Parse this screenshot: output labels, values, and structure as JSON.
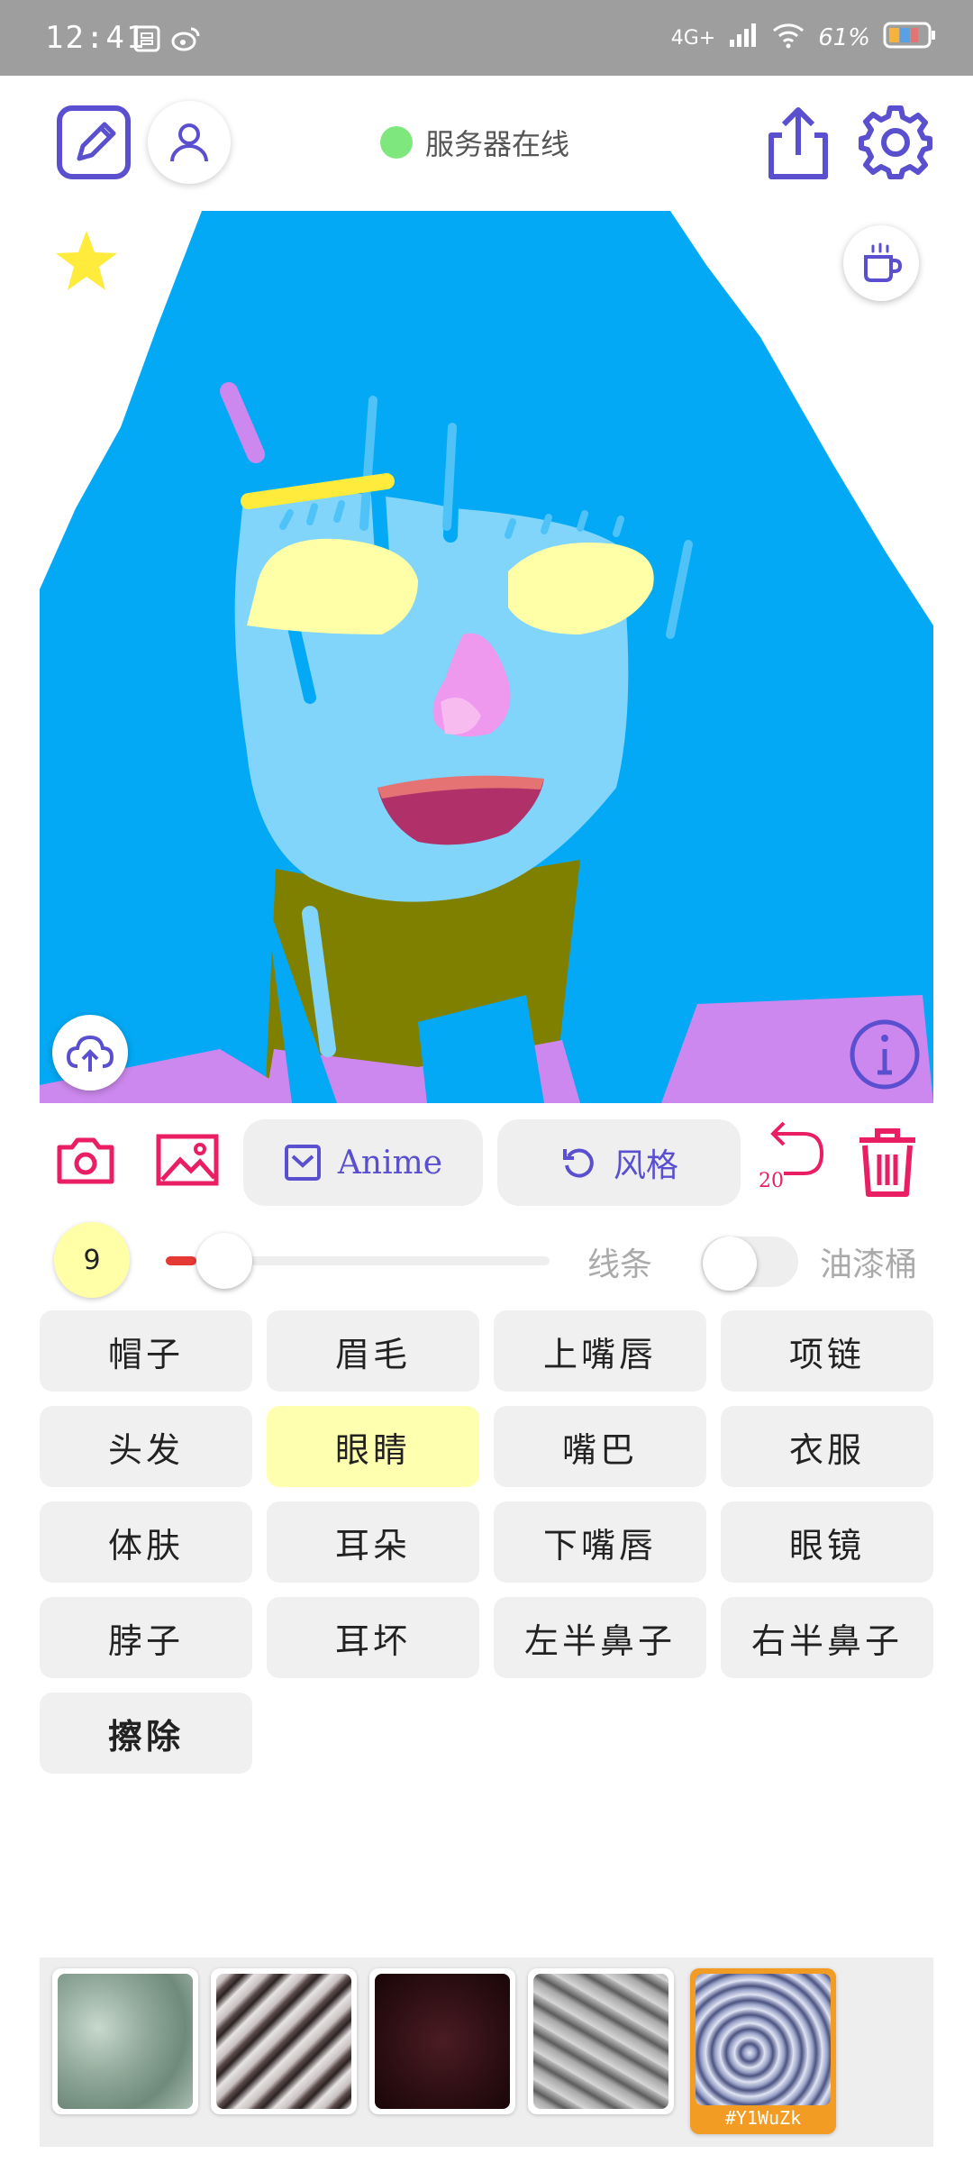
{
  "status_bar": {
    "time": "12:41",
    "network": "4G+",
    "battery": "61%",
    "icons": [
      "notification-icon",
      "weibo-icon",
      "signal-icon",
      "wifi-icon",
      "battery-icon"
    ]
  },
  "header": {
    "server_status": "服务器在线",
    "server_status_color": "#7ee87e",
    "accent_color": "#5a4fcf",
    "icons": [
      "edit-icon",
      "user-icon",
      "share-icon",
      "settings-icon"
    ]
  },
  "canvas": {
    "icons": [
      "star-icon",
      "coffee-icon",
      "cloud-upload-icon",
      "info-icon"
    ]
  },
  "toolbar": {
    "anime_label": "Anime",
    "style_label": "风格",
    "undo_count": "20",
    "icons": [
      "camera-icon",
      "image-icon",
      "anime-checkbox-icon",
      "refresh-icon",
      "undo-icon",
      "trash-icon"
    ]
  },
  "brush": {
    "size": "9",
    "slider_value": 0.08,
    "line_label": "线条",
    "bucket_label": "油漆桶",
    "bucket_enabled": false
  },
  "parts": [
    {
      "label": "帽子",
      "active": false
    },
    {
      "label": "眉毛",
      "active": false
    },
    {
      "label": "上嘴唇",
      "active": false
    },
    {
      "label": "项链",
      "active": false
    },
    {
      "label": "头发",
      "active": false
    },
    {
      "label": "眼睛",
      "active": true
    },
    {
      "label": "嘴巴",
      "active": false
    },
    {
      "label": "衣服",
      "active": false
    },
    {
      "label": "体肤",
      "active": false
    },
    {
      "label": "耳朵",
      "active": false
    },
    {
      "label": "下嘴唇",
      "active": false
    },
    {
      "label": "眼镜",
      "active": false
    },
    {
      "label": "脖子",
      "active": false
    },
    {
      "label": "耳坏",
      "active": false
    },
    {
      "label": "左半鼻子",
      "active": false
    },
    {
      "label": "右半鼻子",
      "active": false
    },
    {
      "label": "擦除",
      "active": false
    }
  ],
  "textures": {
    "selected_caption": "#Y1WuZk"
  }
}
